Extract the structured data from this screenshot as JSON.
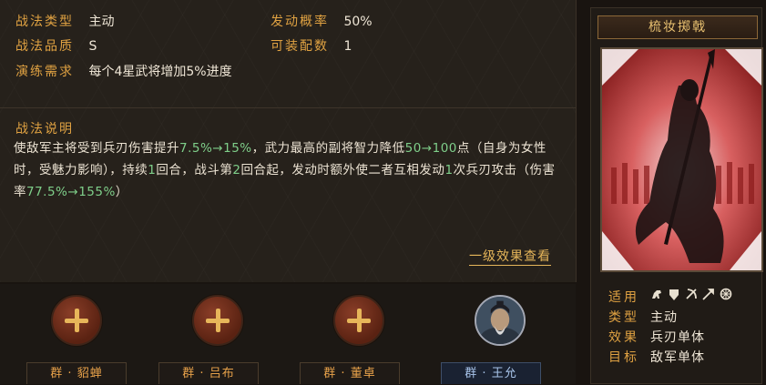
{
  "tactic_info": {
    "type_label": "战法类型",
    "type_value": "主动",
    "grade_label": "战法品质",
    "grade_value": "S",
    "requirement_label": "演练需求",
    "requirement_value": "每个4星武将增加5%进度",
    "prob_label": "发动概率",
    "prob_value": "50%",
    "equip_label": "可装配数",
    "equip_value": "1"
  },
  "description": {
    "title": "战法说明",
    "p1": "使敌军主将受到兵刃伤害提升",
    "h1": "7.5%→15%",
    "p2": "，武力最高的副将智力降低",
    "h2": "50→100",
    "p3": "点（自身为女性时，受魅力影响），持续",
    "h3": "1",
    "p4": "回合，战斗第",
    "h4": "2",
    "p5": "回合起，发动时额外使二者互相发动",
    "h5": "1",
    "p6": "次兵刃攻击（伤害率",
    "h6": "77.5%→155%",
    "p7": "）",
    "more_link": "一级效果查看"
  },
  "generals": [
    {
      "name": "群 · 貂蝉",
      "state": "add"
    },
    {
      "name": "群 · 吕布",
      "state": "add"
    },
    {
      "name": "群 · 董卓",
      "state": "add"
    },
    {
      "name": "群 · 王允",
      "state": "portrait"
    }
  ],
  "card": {
    "title": "梳妆掷戟",
    "applicable_label": "适用",
    "applicable_icons": [
      "cavalry-icon",
      "shield-icon",
      "bow-icon",
      "spear-icon",
      "wheel-icon"
    ],
    "category_label": "类型",
    "category_value": "主动",
    "effect_label": "效果",
    "effect_value": "兵刃单体",
    "target_label": "目标",
    "target_value": "敌军单体"
  },
  "colors": {
    "label_gold": "#e0a242",
    "highlight_green": "#7fcf8a",
    "text_light": "#efe6d6",
    "name_blue": "#a8c4ea"
  }
}
